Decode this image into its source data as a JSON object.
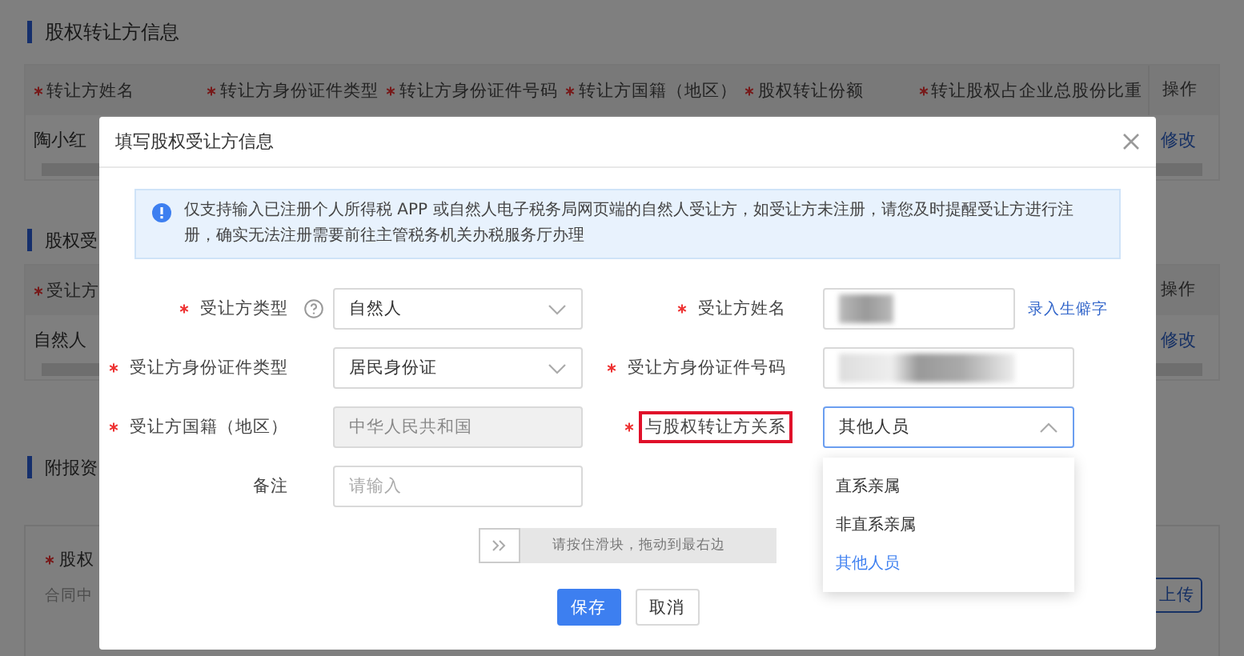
{
  "page": {
    "transferor_section": {
      "title": "股权转让方信息",
      "columns": [
        {
          "label": "转让方姓名",
          "required": true
        },
        {
          "label": "转让方身份证件类型",
          "required": true
        },
        {
          "label": "转让方身份证件号码",
          "required": true
        },
        {
          "label": "转让方国籍（地区）",
          "required": true
        },
        {
          "label": "股权转让份额",
          "required": true
        },
        {
          "label": "转让股权占企业总股份比重",
          "required": true
        }
      ],
      "action_column": "操作",
      "rows": [
        {
          "name": "陶小红",
          "action": "修改"
        }
      ]
    },
    "transferee_section": {
      "title": "股权受",
      "column": {
        "label": "受让方",
        "required": true
      },
      "action_column": "操作",
      "rows": [
        {
          "type": "自然人",
          "action": "修改"
        }
      ]
    },
    "attachments_section": {
      "title": "附报资",
      "item_label": "股权",
      "item_required": true,
      "item_hint": "合同中",
      "upload_button": "上传"
    }
  },
  "dialog": {
    "title": "填写股权受让方信息",
    "notice": "仅支持输入已注册个人所得税 APP 或自然人电子税务局网页端的自然人受让方，如受让方未注册，请您及时提醒受让方进行注册，确实无法注册需要前往主管税务机关办税服务厅办理",
    "form_rows": [
      {
        "fields": [
          {
            "label": "受让方类型",
            "required": true,
            "kind": "select",
            "value": "自然人",
            "help": true
          },
          {
            "label": "受让方姓名",
            "required": true,
            "kind": "redacted",
            "link": "录入生僻字"
          }
        ]
      },
      {
        "fields": [
          {
            "label": "受让方身份证件类型",
            "required": true,
            "kind": "select",
            "value": "居民身份证"
          },
          {
            "label": "受让方身份证件号码",
            "required": true,
            "kind": "redacted"
          }
        ]
      },
      {
        "fields": [
          {
            "label": "受让方国籍（地区）",
            "required": true,
            "kind": "disabled",
            "value": "中华人民共和国"
          },
          {
            "label": "与股权转让方关系",
            "required": true,
            "kind": "select",
            "value": "其他人员",
            "expanded": true,
            "highlighted": true,
            "options": [
              {
                "label": "直系亲属",
                "selected": false
              },
              {
                "label": "非直系亲属",
                "selected": false
              },
              {
                "label": "其他人员",
                "selected": true
              }
            ]
          }
        ]
      },
      {
        "fields": [
          {
            "label": "备注",
            "required": false,
            "kind": "text",
            "placeholder": "请输入"
          }
        ]
      }
    ],
    "slider": {
      "hint": "请按住滑块，拖动到最右边"
    },
    "buttons": [
      {
        "label": "保存",
        "kind": "primary"
      },
      {
        "label": "取消",
        "kind": "default"
      }
    ]
  }
}
